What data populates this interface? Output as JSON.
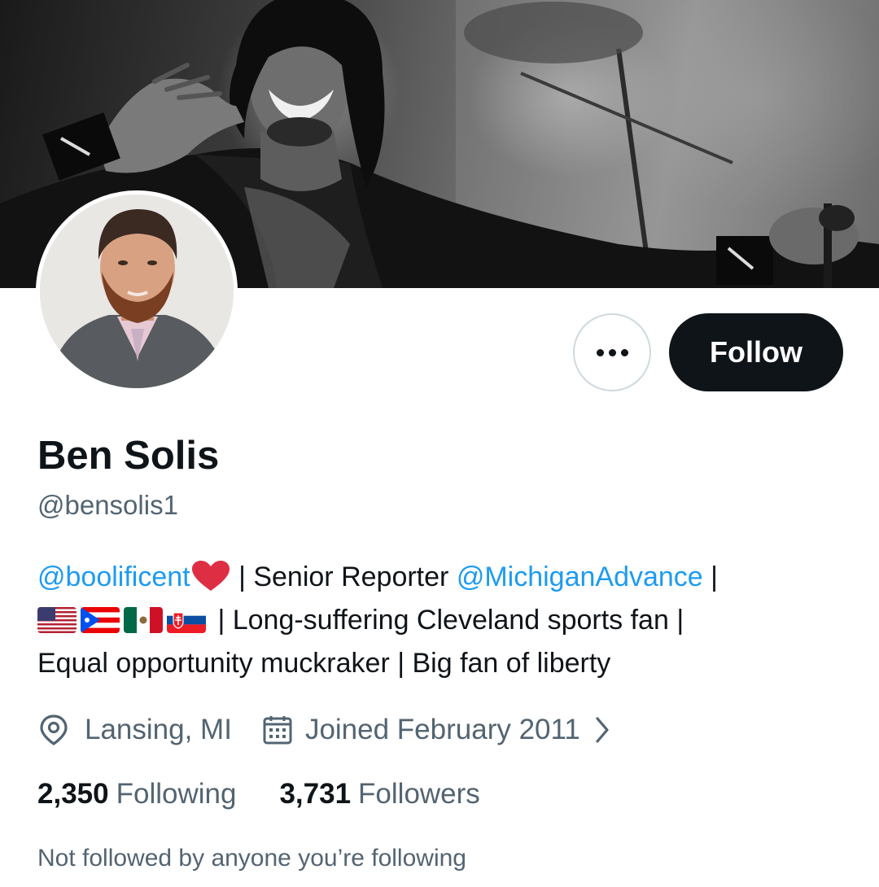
{
  "profile": {
    "display_name": "Ben Solis",
    "handle": "@bensolis1",
    "follow_label": "Follow",
    "more_icon": "more-horizontal-icon"
  },
  "bio": {
    "line1": {
      "mention1": "@boolificent",
      "emoji": "red-heart-icon",
      "text1": " | Senior Reporter ",
      "mention2": "@MichiganAdvance",
      "text2": " |"
    },
    "line2": {
      "flags": [
        "flag-united-states-icon",
        "flag-puerto-rico-icon",
        "flag-mexico-icon",
        "flag-slovakia-icon"
      ],
      "text": " | Long-suffering Cleveland sports fan |"
    },
    "line3": {
      "text": "Equal opportunity muckraker | Big fan of liberty"
    }
  },
  "meta": {
    "location": "Lansing, MI",
    "location_icon": "location-pin-icon",
    "joined": "Joined February 2011",
    "joined_icon": "calendar-icon",
    "chevron_icon": "chevron-right-icon"
  },
  "stats": {
    "following_count": "2,350",
    "following_label": "Following",
    "followers_count": "3,731",
    "followers_label": "Followers"
  },
  "not_followed_text": "Not followed by anyone you’re following",
  "colors": {
    "link": "#1d9bf0",
    "text_primary": "#0f1419",
    "text_secondary": "#536471",
    "button_dark": "#0f1419",
    "border": "#cfd9de"
  }
}
